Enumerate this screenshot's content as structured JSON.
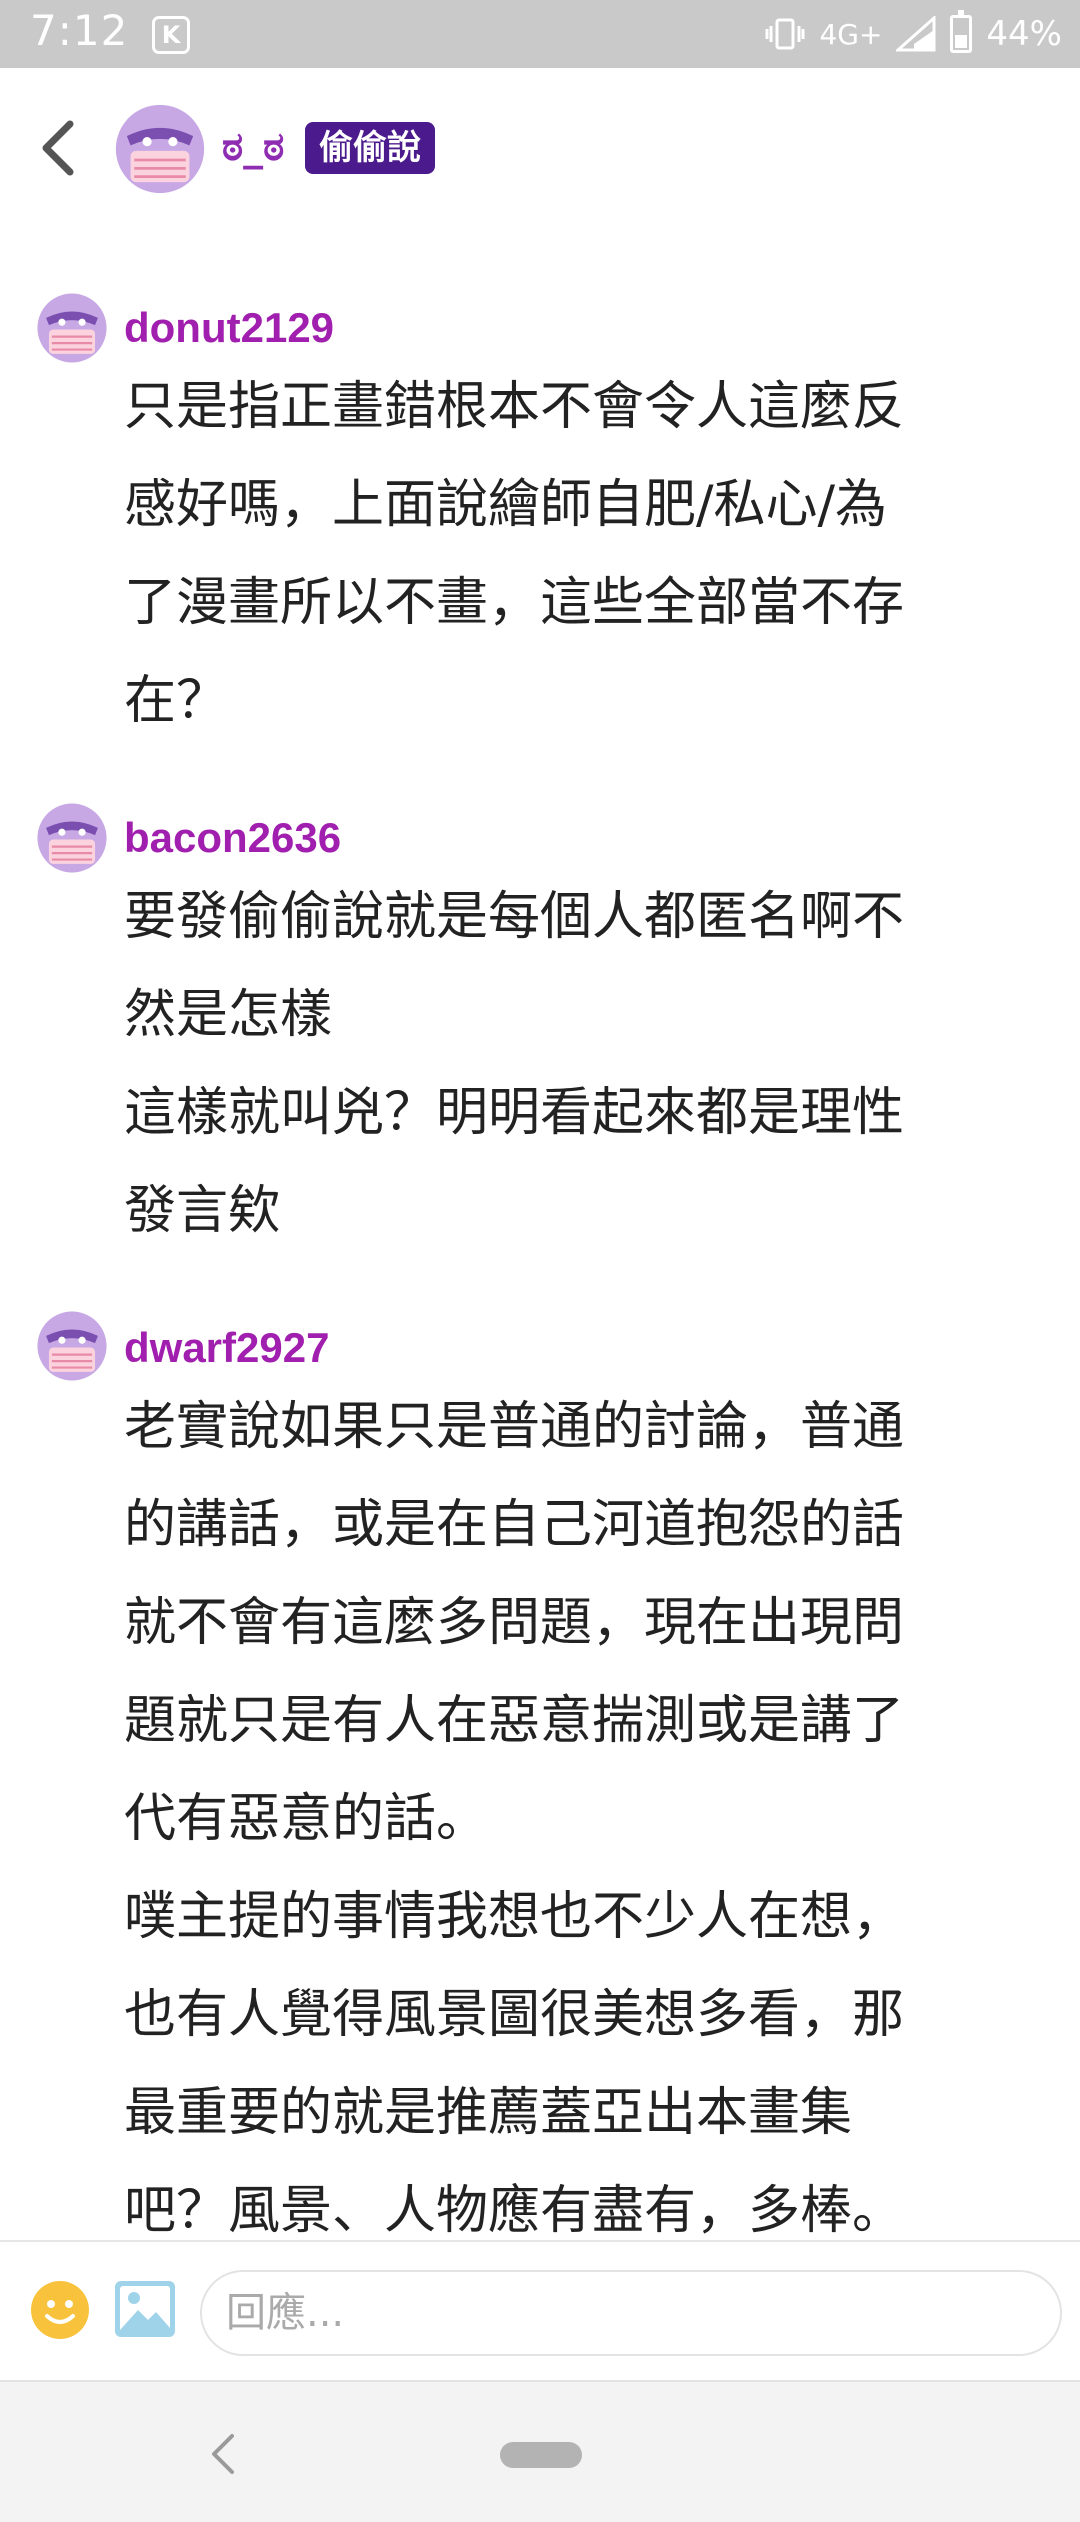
{
  "status_bar": {
    "time": "7:12",
    "network": "4G+",
    "battery": "44%",
    "icons": [
      "k-app-icon",
      "vibrate-icon",
      "signal-icon",
      "battery-icon"
    ]
  },
  "header": {
    "username": "ಠ_ಠ",
    "badge": "偷偷說",
    "icons": [
      "back-icon",
      "masked-avatar-icon"
    ]
  },
  "comments": [
    {
      "user": "donut2129",
      "text": "只是指正畫錯根本不會令人這麼反\n感好嗎，上面說繪師自肥/私心/為\n了漫畫所以不畫，這些全部當不存\n在？"
    },
    {
      "user": "bacon2636",
      "text": "要發偷偷說就是每個人都匿名啊不\n然是怎樣\n這樣就叫兇？明明看起來都是理性\n發言欸"
    },
    {
      "user": "dwarf2927",
      "text": "老實說如果只是普通的討論，普通\n的講話，或是在自己河道抱怨的話\n就不會有這麼多問題，現在出現問\n題就只是有人在惡意揣測或是講了\n代有惡意的話。\n噗主提的事情我想也不少人在想，\n也有人覺得風景圖很美想多看，那\n最重要的就是推薦蓋亞出本畫集\n吧？風景、人物應有盡有，多棒。"
    }
  ],
  "reply": {
    "placeholder": "回應..."
  },
  "colors": {
    "username": "#a11fae",
    "badge_bg": "#4b1a8c",
    "avatar_purple": "#b48fd6",
    "mask_pink": "#f4b6c8"
  }
}
